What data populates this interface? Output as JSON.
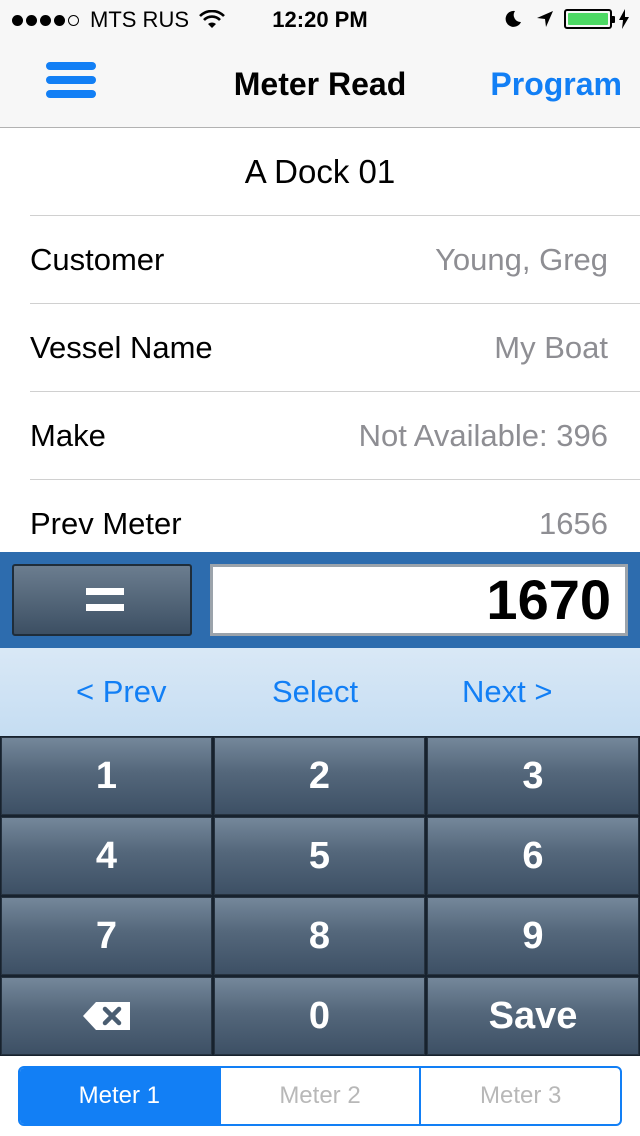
{
  "status_bar": {
    "carrier": "MTS RUS",
    "time": "12:20 PM",
    "signal_strength": 4,
    "battery_color": "#4cd964"
  },
  "nav": {
    "title": "Meter Read",
    "right_button": "Program",
    "accent_color": "#127ff5"
  },
  "location": "A Dock 01",
  "fields": [
    {
      "label": "Customer",
      "value": "Young, Greg"
    },
    {
      "label": "Vessel Name",
      "value": "My Boat"
    },
    {
      "label": "Make",
      "value": "Not Available: 396"
    },
    {
      "label": "Prev Meter",
      "value": "1656"
    }
  ],
  "input": {
    "equals_label": "=",
    "display_value": "1670"
  },
  "selection": {
    "prev": "< Prev",
    "select": "Select",
    "next": "Next >"
  },
  "keypad": {
    "k1": "1",
    "k2": "2",
    "k3": "3",
    "k4": "4",
    "k5": "5",
    "k6": "6",
    "k7": "7",
    "k8": "8",
    "k9": "9",
    "k0": "0",
    "save": "Save",
    "backspace_icon": "backspace-icon"
  },
  "tabs": [
    {
      "label": "Meter 1",
      "active": true
    },
    {
      "label": "Meter 2",
      "active": false
    },
    {
      "label": "Meter 3",
      "active": false
    }
  ]
}
